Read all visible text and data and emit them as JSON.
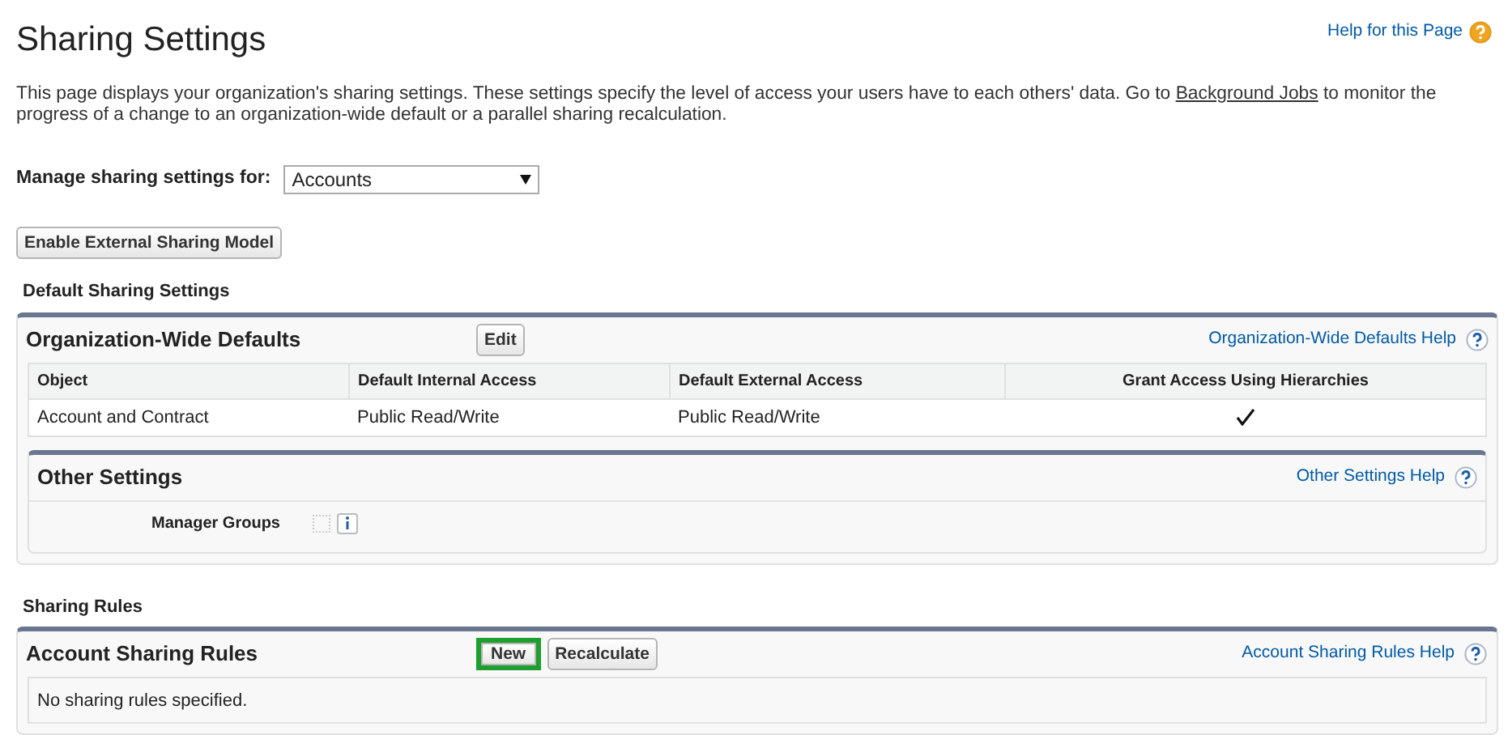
{
  "page_title": "Sharing Settings",
  "help_link": "Help for this Page",
  "intro": {
    "before": "This page displays your organization's sharing settings. These settings specify the level of access your users have to each others' data. Go to",
    "link": "Background Jobs",
    "after": "to monitor the progress of a change to an organization-wide default or a parallel sharing recalculation."
  },
  "manage_for": {
    "label": "Manage sharing settings for:",
    "value": "Accounts"
  },
  "enable_button": "Enable External Sharing Model",
  "default_section": {
    "title": "Default Sharing Settings",
    "org_defaults": {
      "title": "Organization-Wide Defaults",
      "buttons": [
        {
          "label": "Edit",
          "highlighted": false
        }
      ],
      "help": "Organization-Wide Defaults Help",
      "columns": [
        "Object",
        "Default Internal Access",
        "Default External Access",
        "Grant Access Using Hierarchies"
      ],
      "rows": [
        {
          "object": "Account and Contract",
          "internal": "Public Read/Write",
          "external": "Public Read/Write",
          "grant_checked": true
        }
      ]
    },
    "other_settings": {
      "title": "Other Settings",
      "help": "Other Settings Help",
      "fields": [
        {
          "label": "Manager Groups",
          "checked": false
        }
      ]
    }
  },
  "rules_section": {
    "title": "Sharing Rules",
    "panel": {
      "title": "Account Sharing Rules",
      "buttons": [
        {
          "label": "New",
          "highlighted": true
        },
        {
          "label": "Recalculate",
          "highlighted": false
        }
      ],
      "help": "Account Sharing Rules Help",
      "empty": "No sharing rules specified."
    }
  }
}
